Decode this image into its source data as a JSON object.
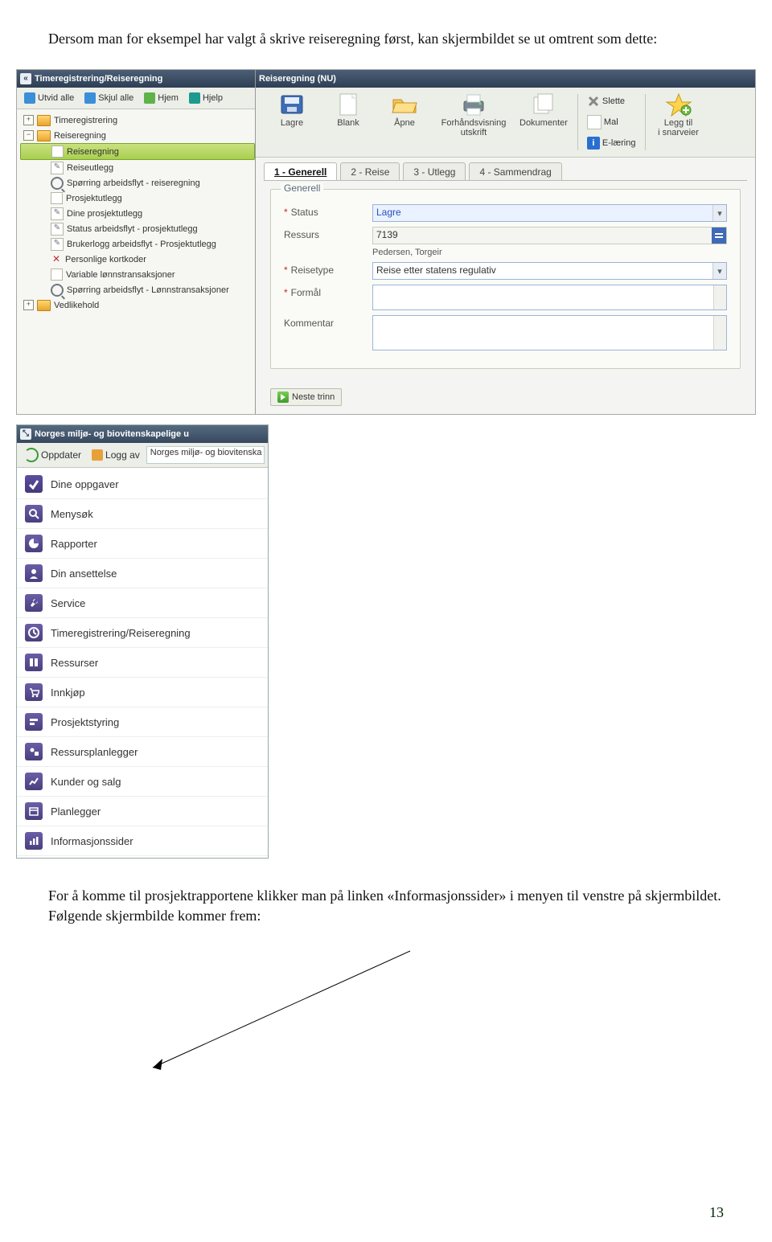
{
  "doc": {
    "intro": "Dersom man for eksempel har valgt å skrive reiseregning først, kan skjermbildet se ut omtrent som dette:",
    "outro": "For å komme til prosjektrapportene klikker man på linken «Informasjonssider» i menyen til venstre på skjermbildet. Følgende skjermbilde kommer frem:",
    "page_number": "13"
  },
  "shot1": {
    "nav_title": "Timeregistrering/Reiseregning",
    "nav_buttons": {
      "expand": "Utvid alle",
      "collapse": "Skjul alle",
      "home": "Hjem",
      "help": "Hjelp"
    },
    "tree": {
      "root1": "Timeregistrering",
      "root2": "Reiseregning",
      "items": [
        "Reiseregning",
        "Reiseutlegg",
        "Spørring arbeidsflyt - reiseregning",
        "Prosjektutlegg",
        "Dine prosjektutlegg",
        "Status arbeidsflyt - prosjektutlegg",
        "Brukerlogg arbeidsflyt - Prosjektutlegg",
        "Personlige kortkoder",
        "Variable lønnstransaksjoner",
        "Spørring arbeidsflyt - Lønnstransaksjoner"
      ],
      "root3": "Vedlikehold"
    },
    "main_title": "Reiseregning (NU)",
    "toolbar": {
      "save": "Lagre",
      "blank": "Blank",
      "open": "Åpne",
      "preview": "Forhåndsvisning\nutskrift",
      "docs": "Dokumenter",
      "delete": "Slette",
      "template": "Mal",
      "elearn": "E-læring",
      "addshort": "Legg til\ni snarveier"
    },
    "tabs": {
      "t1": "1 - Generell",
      "t2": "2 - Reise",
      "t3": "3 - Utlegg",
      "t4": "4 - Sammendrag"
    },
    "form": {
      "legend": "Generell",
      "status_label": "Status",
      "status_value": "Lagre",
      "resource_label": "Ressurs",
      "resource_value": "7139",
      "resource_name": "Pedersen, Torgeir",
      "type_label": "Reisetype",
      "type_value": "Reise etter statens regulativ",
      "purpose_label": "Formål",
      "comment_label": "Kommentar"
    },
    "next": "Neste trinn"
  },
  "shot2": {
    "title_truncated": "Norges miljø- og biovitenskapelige u",
    "buttons": {
      "refresh": "Oppdater",
      "logoff": "Logg av"
    },
    "search_text": "Norges miljø- og biovitenska",
    "items": [
      "Dine oppgaver",
      "Menysøk",
      "Rapporter",
      "Din ansettelse",
      "Service",
      "Timeregistrering/Reiseregning",
      "Ressurser",
      "Innkjøp",
      "Prosjektstyring",
      "Ressursplanlegger",
      "Kunder og salg",
      "Planlegger",
      "Informasjonssider"
    ]
  }
}
